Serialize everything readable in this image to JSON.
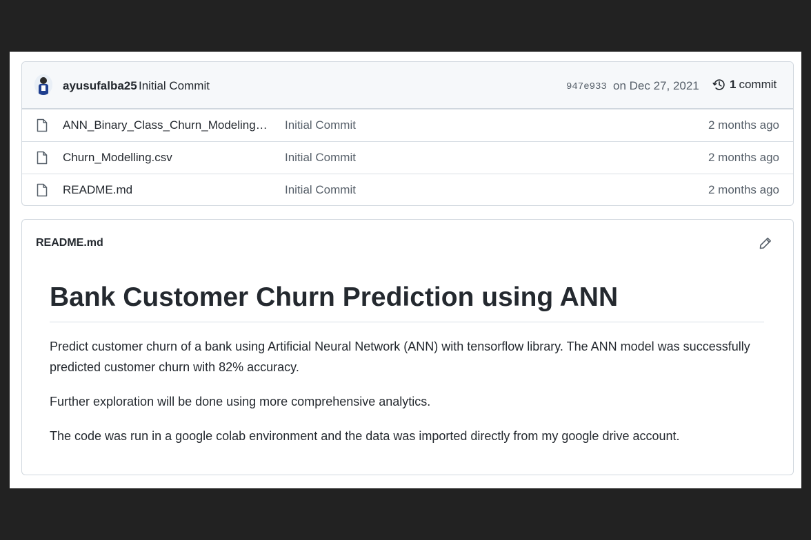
{
  "commit": {
    "author": "ayusufalba25",
    "message": "Initial Commit",
    "hash": "947e933",
    "date": "on Dec 27, 2021",
    "count": "1",
    "count_label": "commit"
  },
  "files": [
    {
      "name": "ANN_Binary_Class_Churn_Modeling.i...",
      "commit": "Initial Commit",
      "age": "2 months ago",
      "icon": "file-icon"
    },
    {
      "name": "Churn_Modelling.csv",
      "commit": "Initial Commit",
      "age": "2 months ago",
      "icon": "file-icon"
    },
    {
      "name": "README.md",
      "commit": "Initial Commit",
      "age": "2 months ago",
      "icon": "file-icon"
    }
  ],
  "readme": {
    "header": "README.md",
    "edit_icon": "pencil-icon",
    "title": "Bank Customer Churn Prediction using ANN",
    "paragraphs": [
      "Predict customer churn of a bank using Artificial Neural Network (ANN) with tensorflow library. The ANN model was successfully predicted customer churn with 82% accuracy.",
      "Further exploration will be done using more comprehensive analytics.",
      "The code was run in a google colab environment and the data was imported directly from my google drive account."
    ]
  },
  "colors": {
    "frame_background": "#222222",
    "border": "#d0d7de",
    "muted_text": "#57606a",
    "text": "#24292f"
  }
}
